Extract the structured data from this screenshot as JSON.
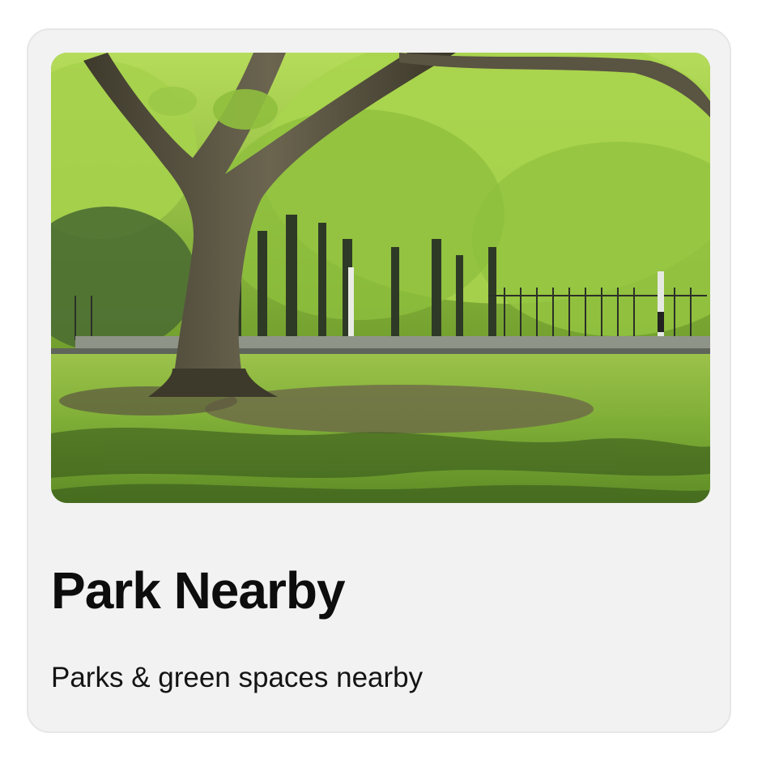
{
  "card": {
    "title": "Park Nearby",
    "subtitle": "Parks & green spaces nearby",
    "image_alt": "Park with a large tree over a grassy lawn",
    "colors": {
      "card_background": "#f2f2f2",
      "card_border": "#e6e6e6",
      "title_text": "#0d0d0d",
      "subtitle_text": "#141414"
    }
  }
}
